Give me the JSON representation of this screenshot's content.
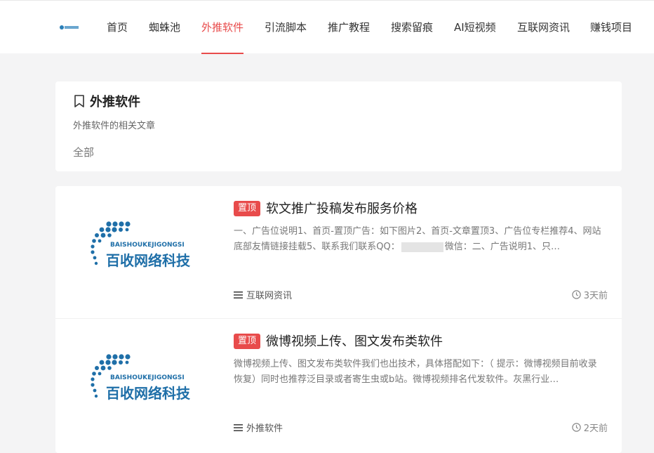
{
  "header": {
    "nav": [
      {
        "label": "首页",
        "active": false
      },
      {
        "label": "蜘蛛池",
        "active": false
      },
      {
        "label": "外推软件",
        "active": true
      },
      {
        "label": "引流脚本",
        "active": false
      },
      {
        "label": "推广教程",
        "active": false
      },
      {
        "label": "搜索留痕",
        "active": false
      },
      {
        "label": "AI短视频",
        "active": false
      },
      {
        "label": "互联网资讯",
        "active": false
      },
      {
        "label": "赚钱项目",
        "active": false
      }
    ]
  },
  "category": {
    "title": "外推软件",
    "description": "外推软件的相关文章",
    "filter": "全部"
  },
  "thumbnail": {
    "brand_en": "BAISHOUKEJIGONGSI",
    "brand_cn": "百收网络科技"
  },
  "posts": [
    {
      "badge": "置顶",
      "title": "软文推广投稿发布服务价格",
      "excerpt_a": "一、广告位说明1、首页-置顶广告：如下图片2、首页-文章置顶3、广告位专栏推荐4、网站底部友情链接挂载5、联系我们联系QQ：",
      "excerpt_b": "微信：二、广告说明1、只…",
      "category": "互联网资讯",
      "time": "3天前"
    },
    {
      "badge": "置顶",
      "title": "微博视频上传、图文发布类软件",
      "excerpt_a": "微博视频上传、图文发布类软件我们也出技术，具体搭配如下：（ 提示：微博视频目前收录恢复）同时也推荐泛目录或者寄生虫或b站。微博视频排名代发软件。灰黑行业…",
      "excerpt_b": "",
      "category": "外推软件",
      "time": "2天前"
    }
  ],
  "colors": {
    "accent": "#e84b4b",
    "brand_blue": "#1f6fa8"
  }
}
